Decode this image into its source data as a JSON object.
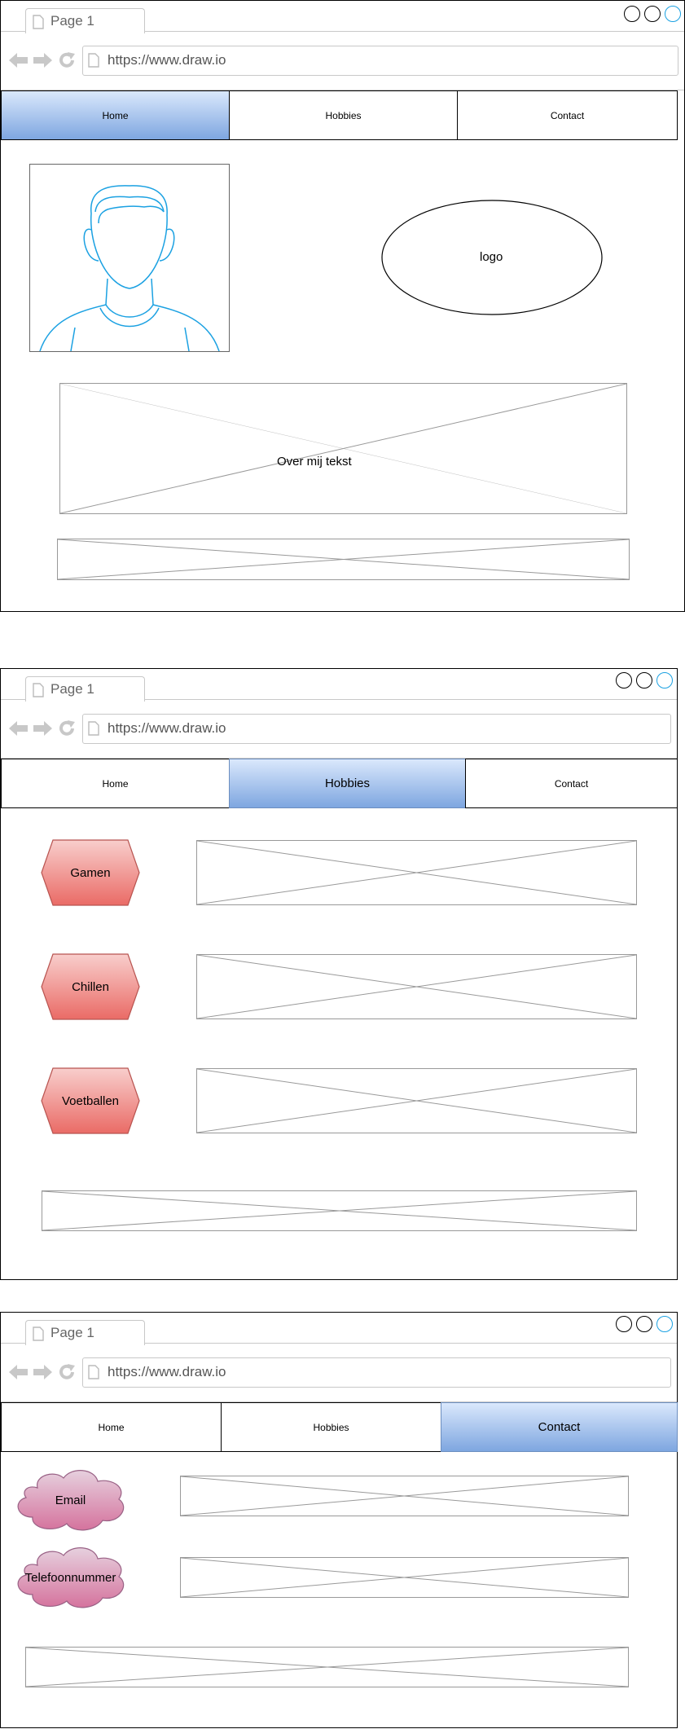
{
  "pages": [
    {
      "tab_title": "Page 1",
      "url": "https://www.draw.io",
      "nav": [
        "Home",
        "Hobbies",
        "Contact"
      ],
      "active_nav": "Home",
      "logo_label": "logo",
      "about_label": "Over mij tekst"
    },
    {
      "tab_title": "Page 1",
      "url": "https://www.draw.io",
      "nav": [
        "Home",
        "Hobbies",
        "Contact"
      ],
      "active_nav": "Hobbies",
      "hobbies": [
        "Gamen",
        "Chillen",
        "Voetballen"
      ]
    },
    {
      "tab_title": "Page 1",
      "url": "https://www.draw.io",
      "nav": [
        "Home",
        "Hobbies",
        "Contact"
      ],
      "active_nav": "Contact",
      "contacts": [
        "Email",
        "Telefoonnummer"
      ]
    }
  ],
  "colors": {
    "nav_active_top": "#dae8fc",
    "nav_active_bottom": "#7ea6e0",
    "hexagon_fill_top": "#f8cecc",
    "hexagon_fill_bottom": "#ea6b66",
    "hexagon_stroke": "#b85450",
    "cloud_fill_top": "#e6d0de",
    "cloud_fill_bottom": "#d5739d",
    "cloud_stroke": "#996185",
    "avatar_stroke": "#1ba1e2",
    "window_close": "#1ba1e2"
  }
}
